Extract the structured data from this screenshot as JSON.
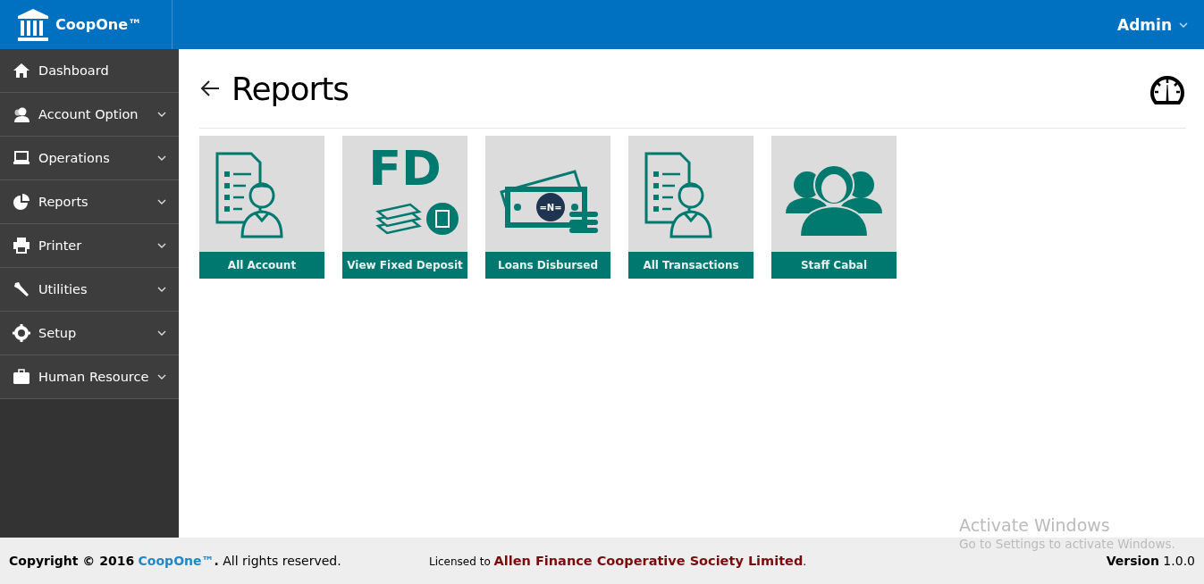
{
  "header": {
    "brand": "CoopOne™",
    "user": "Admin"
  },
  "sidebar": {
    "items": [
      {
        "label": "Dashboard",
        "submenu": false
      },
      {
        "label": "Account Option",
        "submenu": true
      },
      {
        "label": "Operations",
        "submenu": true
      },
      {
        "label": "Reports",
        "submenu": true
      },
      {
        "label": "Printer",
        "submenu": true
      },
      {
        "label": "Utilities",
        "submenu": true
      },
      {
        "label": "Setup",
        "submenu": true
      },
      {
        "label": "Human Resource",
        "submenu": true
      }
    ]
  },
  "page": {
    "title": "Reports"
  },
  "tiles": [
    {
      "label": "All Account"
    },
    {
      "label": "View Fixed Deposit",
      "image_text": "FD"
    },
    {
      "label": "Loans Disbursed",
      "image_text": "=N="
    },
    {
      "label": "All Transactions"
    },
    {
      "label": "Staff Cabal"
    }
  ],
  "footer": {
    "copyright_prefix": "**Copyright © 2016**",
    "copyright_brand": "CoopOne™",
    "copyright_suffix": "**.** All rights reserved.",
    "license": "Licensed to **Allen Finance Cooperative Society Limited**.",
    "version": "**Version** 1.0.0"
  },
  "os_notice": {
    "title": "Activate Windows",
    "text": "Go to Settings to activate Windows."
  }
}
